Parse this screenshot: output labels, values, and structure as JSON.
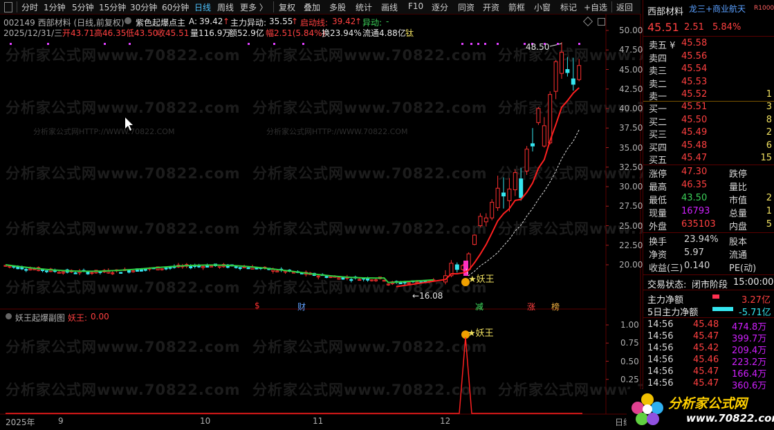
{
  "toolbar": {
    "items": [
      "分时",
      "1分钟",
      "5分钟",
      "15分钟",
      "30分钟",
      "60分钟",
      "日线",
      "周线",
      "更多 〉",
      "复权",
      "叠加",
      "多股",
      "统计",
      "画线",
      "F10",
      "逐分",
      "同资",
      "开资",
      "箭框",
      "小窗",
      "标记",
      "+自选",
      "返回"
    ]
  },
  "info": {
    "code_line": "002149 西部材料 (日线,前复权)",
    "indicator_name": "紫色起爆点主",
    "a_label": "A:",
    "a_value": "39.42",
    "main_flow_label": "主力异动:",
    "main_flow_value": "35.55",
    "start_label": "启动线:",
    "start_value": "39.42",
    "anomaly_label": "异动:",
    "anomaly_value": "-",
    "date": "2025/12/31/三",
    "open": "开43.71",
    "high": "高46.35",
    "low": "低43.50",
    "close": "收45.51",
    "volume": "量116.9万",
    "amount": "额52.9亿",
    "change": "幅2.51(5.84%)",
    "turnover": "换23.94%",
    "float_cap": "流通4.88亿",
    "tag": "钛"
  },
  "main_axis": [
    "50.00",
    "47.50",
    "45.00",
    "42.50",
    "40.00",
    "37.50",
    "35.00",
    "32.50",
    "30.00",
    "27.50",
    "25.00",
    "22.50",
    "20.00"
  ],
  "annotations": {
    "peak_price": "48.50",
    "low_price": "16.08",
    "yaowang": "妖王",
    "events": [
      "$",
      "财",
      "减",
      "涨",
      "榜"
    ]
  },
  "watermarks": {
    "big": "分析家公式网www.70822.com",
    "small": "分析家公式网HTTP://WWW.70822.COM"
  },
  "sub": {
    "title": "妖王起爆副图",
    "label": "妖王:",
    "value": "0.00",
    "axis": [
      "1.00",
      "0.75",
      "0.50",
      "0.25"
    ]
  },
  "x_axis": {
    "labels": [
      "2025年",
      "9",
      "10",
      "11",
      "12"
    ],
    "right_label": "日线"
  },
  "chart_data": {
    "type": "candlestick",
    "price_axis_ticks": [
      20,
      22.5,
      25,
      27.5,
      30,
      32.5,
      35,
      37.5,
      40,
      42.5,
      45,
      47.5,
      50
    ],
    "last_candles": [
      {
        "o": 17.8,
        "c": 18.6,
        "h": 19.3,
        "l": 17.5
      },
      {
        "o": 18.6,
        "c": 20.2,
        "h": 20.6,
        "l": 18.4
      },
      {
        "o": 20.0,
        "c": 19.4,
        "h": 20.3,
        "l": 19.0
      },
      {
        "o": 19.4,
        "c": 19.9,
        "h": 20.1,
        "l": 19.2
      },
      {
        "o": 19.4,
        "c": 21.4,
        "h": 21.6,
        "l": 19.3
      },
      {
        "o": 22.6,
        "c": 23.8,
        "h": 23.9,
        "l": 22.5
      },
      {
        "o": 25.0,
        "c": 26.2,
        "h": 26.6,
        "l": 24.8
      },
      {
        "o": 25.5,
        "c": 26.0,
        "h": 26.6,
        "l": 24.9
      },
      {
        "o": 26.0,
        "c": 28.0,
        "h": 28.4,
        "l": 25.7
      },
      {
        "o": 27.3,
        "c": 29.8,
        "h": 31.4,
        "l": 26.9
      },
      {
        "o": 29.2,
        "c": 28.8,
        "h": 31.2,
        "l": 27.2
      },
      {
        "o": 28.2,
        "c": 29.7,
        "h": 31.1,
        "l": 26.8
      },
      {
        "o": 29.6,
        "c": 31.8,
        "h": 32.2,
        "l": 28.8
      },
      {
        "o": 31.0,
        "c": 28.6,
        "h": 32.4,
        "l": 28.2
      },
      {
        "o": 32.0,
        "c": 34.8,
        "h": 35.2,
        "l": 31.5
      },
      {
        "o": 35.5,
        "c": 35.2,
        "h": 37.5,
        "l": 34.5
      },
      {
        "o": 38.2,
        "c": 40.0,
        "h": 40.2,
        "l": 37.9
      },
      {
        "o": 35.2,
        "c": 37.8,
        "h": 38.9,
        "l": 35.0
      },
      {
        "o": 35.6,
        "c": 41.8,
        "h": 42.2,
        "l": 35.4
      },
      {
        "o": 42.2,
        "c": 46.0,
        "h": 46.2,
        "l": 41.2
      },
      {
        "o": 44.5,
        "c": 47.2,
        "h": 48.5,
        "l": 43.8
      },
      {
        "o": 45.0,
        "c": 44.6,
        "h": 46.6,
        "l": 44.1
      },
      {
        "o": 43.8,
        "c": 43.1,
        "h": 46.5,
        "l": 42.3
      },
      {
        "o": 43.71,
        "c": 45.51,
        "h": 46.35,
        "l": 43.5
      }
    ]
  },
  "stock_title": "西部材料",
  "concept": "龙三+商业航天",
  "r_badge": "R1000",
  "quote": {
    "price": "45.51",
    "change": "2.51",
    "pct": "5.84%"
  },
  "order_book": {
    "asks": [
      {
        "label": "卖五 ¥",
        "price": "45.58",
        "vol": ""
      },
      {
        "label": "卖四",
        "price": "45.56",
        "vol": ""
      },
      {
        "label": "卖三",
        "price": "45.54",
        "vol": ""
      },
      {
        "label": "卖二",
        "price": "45.53",
        "vol": ""
      },
      {
        "label": "卖一",
        "price": "45.52",
        "vol": "1"
      }
    ],
    "bids": [
      {
        "label": "买一",
        "price": "45.51",
        "vol": "3"
      },
      {
        "label": "买二",
        "price": "45.50",
        "vol": "8"
      },
      {
        "label": "买三",
        "price": "45.49",
        "vol": "2"
      },
      {
        "label": "买四",
        "price": "45.48",
        "vol": "6"
      },
      {
        "label": "买五",
        "price": "45.47",
        "vol": "15"
      }
    ]
  },
  "stats": [
    {
      "l1": "涨停",
      "v1": "47.30",
      "l2": "跌停",
      "v2": ""
    },
    {
      "l1": "最高",
      "v1": "46.35",
      "l2": "量比",
      "v2": ""
    },
    {
      "l1": "最低",
      "v1": "43.50",
      "l2": "市值",
      "v2": "2"
    },
    {
      "l1": "现量",
      "v1": "16793",
      "l2": "总量",
      "v2": "1"
    },
    {
      "l1": "外盘",
      "v1": "635103",
      "l2": "内盘",
      "v2": "5"
    }
  ],
  "stats2": [
    {
      "l1": "换手",
      "v1": "23.94%",
      "l2": "股本"
    },
    {
      "l1": "净资",
      "v1": "5.97",
      "l2": "流通"
    },
    {
      "l1": "收益(三)",
      "v1": "0.140",
      "l2": "PE(动)"
    }
  ],
  "trade_status": {
    "label": "交易状态:",
    "value": "闭市阶段",
    "time": "15:00:00"
  },
  "net_flow": {
    "label": "主力净额",
    "value": "3.27亿",
    "label5": "5日主力净额",
    "value5": "-5.71亿"
  },
  "ticks": [
    {
      "t": "14:56",
      "p": "45.48",
      "v": "474.8万"
    },
    {
      "t": "14:56",
      "p": "45.47",
      "v": "399.7万"
    },
    {
      "t": "14:56",
      "p": "45.42",
      "v": "209.4万"
    },
    {
      "t": "14:56",
      "p": "45.46",
      "v": "223.2万"
    },
    {
      "t": "14:56",
      "p": "45.47",
      "v": "166.4万"
    },
    {
      "t": "14:56",
      "p": "45.47",
      "v": "360.6万"
    }
  ],
  "logo": {
    "title": "分析家公式网",
    "url": "www.70822.com"
  }
}
